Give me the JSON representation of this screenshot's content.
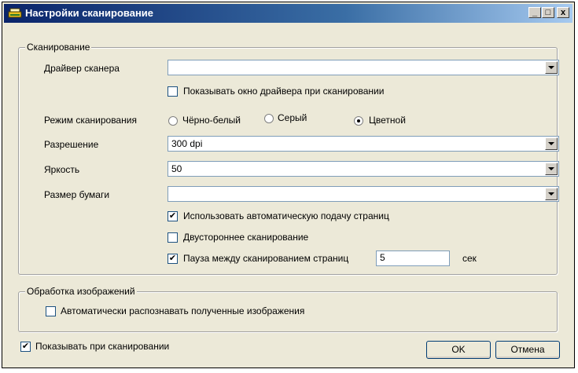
{
  "window": {
    "title": "Настройки сканирование",
    "minimize": "_",
    "maximize": "□",
    "close": "x"
  },
  "scanning": {
    "group_label": "Сканирование",
    "driver_label": "Драйвер сканера",
    "driver_value": "",
    "show_driver_window": {
      "label": "Показывать окно драйвера при сканировании",
      "checked": false
    },
    "mode_label": "Режим сканирования",
    "modes": [
      {
        "label": "Чёрно-белый",
        "checked": false
      },
      {
        "label": "Серый",
        "checked": false
      },
      {
        "label": "Цветной",
        "checked": true
      }
    ],
    "resolution_label": "Разрешение",
    "resolution_value": "300 dpi",
    "brightness_label": "Яркость",
    "brightness_value": "50",
    "paper_label": "Размер бумаги",
    "paper_value": "",
    "auto_feed": {
      "label": "Использовать автоматическую подачу страниц",
      "checked": true
    },
    "duplex": {
      "label": "Двустороннее сканирование",
      "checked": false
    },
    "pause": {
      "label": "Пауза между сканированием страниц",
      "checked": true,
      "value": "5",
      "unit": "сек"
    }
  },
  "processing": {
    "group_label": "Обработка изображений",
    "auto_recognize": {
      "label": "Автоматически распознавать полученные изображения",
      "checked": false
    }
  },
  "footer": {
    "show_when_scanning": {
      "label": "Показывать при сканировании",
      "checked": true
    },
    "ok_label": "OK",
    "cancel_label": "Отмена"
  },
  "check_mark": "✔"
}
